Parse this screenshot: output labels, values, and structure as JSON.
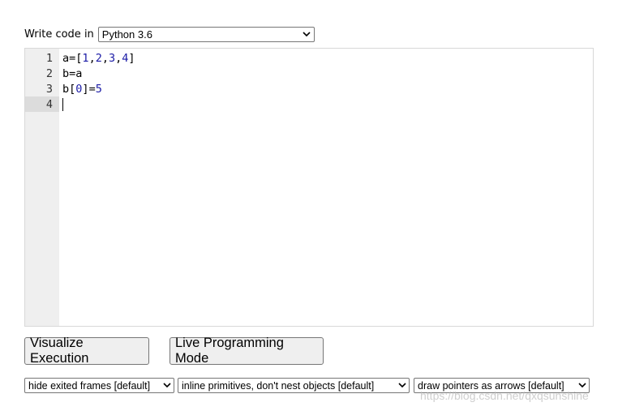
{
  "header": {
    "label": "Write code in",
    "language_select": {
      "value": "Python 3.6",
      "icon": "chevron-down-icon"
    }
  },
  "editor": {
    "lines": [
      {
        "number": "1",
        "tokens": [
          {
            "t": "a",
            "cls": "op"
          },
          {
            "t": "=",
            "cls": "op"
          },
          {
            "t": "[",
            "cls": "op"
          },
          {
            "t": "1",
            "cls": "num"
          },
          {
            "t": ",",
            "cls": "op"
          },
          {
            "t": "2",
            "cls": "num"
          },
          {
            "t": ",",
            "cls": "op"
          },
          {
            "t": "3",
            "cls": "num"
          },
          {
            "t": ",",
            "cls": "op"
          },
          {
            "t": "4",
            "cls": "num"
          },
          {
            "t": "]",
            "cls": "op"
          }
        ]
      },
      {
        "number": "2",
        "tokens": [
          {
            "t": "b",
            "cls": "op"
          },
          {
            "t": "=",
            "cls": "op"
          },
          {
            "t": "a",
            "cls": "op"
          }
        ]
      },
      {
        "number": "3",
        "tokens": [
          {
            "t": "b",
            "cls": "op"
          },
          {
            "t": "[",
            "cls": "op"
          },
          {
            "t": "0",
            "cls": "num"
          },
          {
            "t": "]",
            "cls": "op"
          },
          {
            "t": "=",
            "cls": "op"
          },
          {
            "t": "5",
            "cls": "num"
          }
        ]
      },
      {
        "number": "4",
        "tokens": [],
        "active": true,
        "cursor": true
      }
    ],
    "colors": {
      "gutter": "#efefef",
      "active_line": "#dcdcdc",
      "number_literal": "#1a1aa6"
    }
  },
  "buttons": {
    "visualize_label": "Visualize Execution",
    "live_label": "Live Programming Mode"
  },
  "options": {
    "frames": "hide exited frames [default]",
    "primitives": "inline primitives, don't nest objects [default]",
    "pointers": "draw pointers as arrows [default]"
  },
  "watermark": {
    "text": "https://blog.csdn.net/qxqsunshine"
  }
}
